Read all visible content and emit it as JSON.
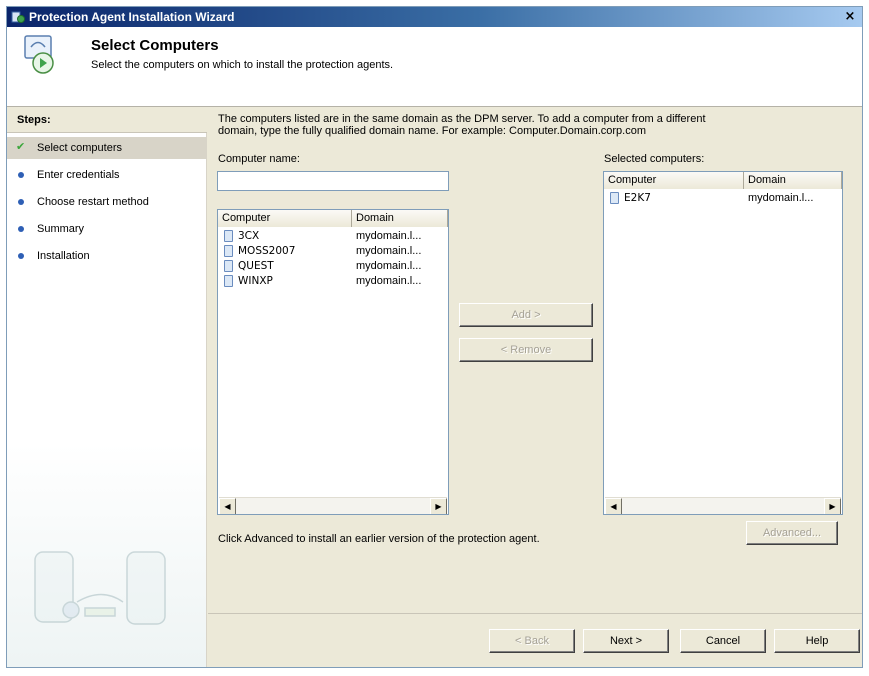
{
  "window": {
    "title": "Protection Agent Installation Wizard",
    "close_symbol": "×"
  },
  "header": {
    "title": "Select Computers",
    "subtitle": "Select the computers on which to install the protection agents."
  },
  "steps": {
    "heading": "Steps:",
    "items": [
      {
        "label": "Select computers",
        "state": "current"
      },
      {
        "label": "Enter credentials",
        "state": "pending"
      },
      {
        "label": "Choose restart method",
        "state": "pending"
      },
      {
        "label": "Summary",
        "state": "pending"
      },
      {
        "label": "Installation",
        "state": "pending"
      }
    ]
  },
  "main": {
    "info_line1": "The computers listed are in the same domain as the DPM server. To add a computer from a different",
    "info_line2": "domain, type the fully qualified domain name. For example: Computer.Domain.corp.com",
    "computer_name_label": "Computer name:",
    "computer_name_value": "",
    "available": {
      "col_computer": "Computer",
      "col_domain": "Domain",
      "rows": [
        {
          "computer": "3CX",
          "domain": "mydomain.l..."
        },
        {
          "computer": "MOSS2007",
          "domain": "mydomain.l..."
        },
        {
          "computer": "QUEST",
          "domain": "mydomain.l..."
        },
        {
          "computer": "WINXP",
          "domain": "mydomain.l..."
        }
      ]
    },
    "selected_label": "Selected computers:",
    "selected": {
      "col_computer": "Computer",
      "col_domain": "Domain",
      "rows": [
        {
          "computer": "E2K7",
          "domain": "mydomain.l..."
        }
      ]
    },
    "add_button": "Add >",
    "remove_button": "< Remove",
    "advanced_note": "Click Advanced to install an earlier version of the protection agent.",
    "advanced_button": "Advanced..."
  },
  "footer": {
    "back": "< Back",
    "next": "Next >",
    "cancel": "Cancel",
    "help": "Help"
  },
  "icons": {
    "title": "wizard-icon",
    "header": "computer-install-icon",
    "step_done": "check-icon",
    "step_pending": "bullet-icon",
    "scroll_left": "arrow-left-icon",
    "scroll_right": "arrow-right-icon",
    "file": "computer-icon"
  },
  "colors": {
    "title_bar": "#0a246a",
    "dialog_bg": "#ece9d8",
    "step_active": "#d8d4c8",
    "step_bullet": "#2e5fb5",
    "step_check": "#3aa63a"
  }
}
